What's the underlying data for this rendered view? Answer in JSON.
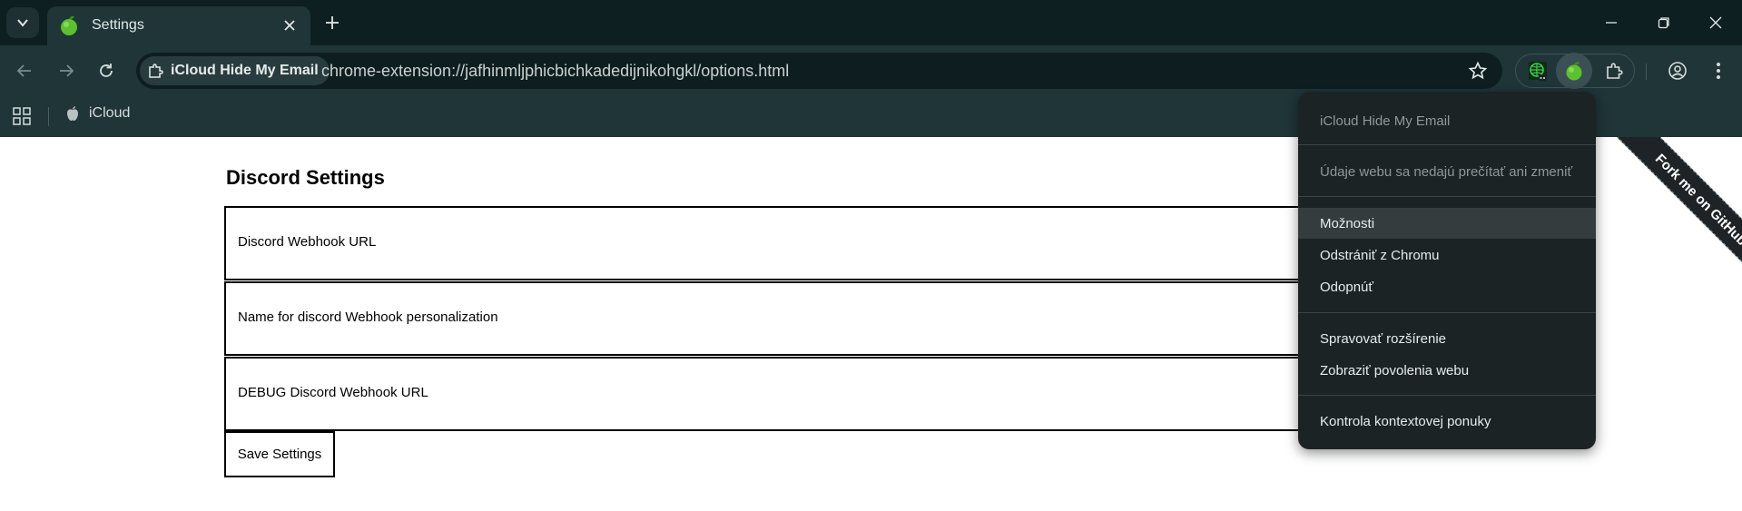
{
  "browser": {
    "tab": {
      "title": "Settings"
    },
    "address": {
      "chip_label": "iCloud Hide My Email",
      "url": "chrome-extension://jafhinmljphicbichkadedijnikohgkl/options.html"
    },
    "bookmarks": [
      {
        "label": "iCloud"
      }
    ]
  },
  "page": {
    "heading": "Discord Settings",
    "fields": [
      {
        "label": "Discord Webhook URL"
      },
      {
        "label": "Name for discord Webhook personalization"
      },
      {
        "label": "DEBUG Discord Webhook URL"
      }
    ],
    "save_button": "Save Settings",
    "ribbon": "Fork me on GitHub"
  },
  "context_menu": {
    "title": "iCloud Hide My Email",
    "site_access": "Údaje webu sa nedajú prečítať ani zmeniť",
    "items": [
      "Možnosti",
      "Odstrániť z Chromu",
      "Odopnúť",
      "Spravovať rozšírenie",
      "Zobraziť povolenia webu",
      "Kontrola kontextovej ponuky"
    ]
  },
  "colors": {
    "tabstrip": "#0d1f21",
    "toolbar": "#1f3538",
    "menu_bg": "#1c2325",
    "accent_green": "#5cc12e"
  }
}
